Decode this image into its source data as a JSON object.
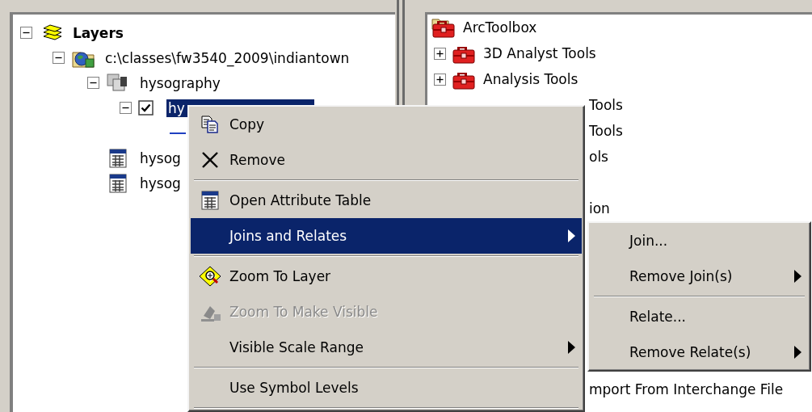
{
  "layers_panel": {
    "tree": [
      {
        "kind": "dataframe",
        "label": "Layers",
        "expanded": true,
        "selected": false,
        "children": [
          {
            "kind": "workspace",
            "label": "c:\\classes\\fw3540_2009\\indiantown",
            "expanded": true,
            "selected": false,
            "children": [
              {
                "kind": "group",
                "label": "hysography",
                "expanded": true,
                "selected": false,
                "children": [
                  {
                    "kind": "layer",
                    "label": "hy",
                    "expanded": true,
                    "checked": true,
                    "selected": true
                  }
                ]
              },
              {
                "kind": "table",
                "label": "hysog",
                "selected": false
              },
              {
                "kind": "table",
                "label": "hysog",
                "selected": false
              }
            ]
          }
        ]
      }
    ]
  },
  "toolbox_panel": {
    "root": "ArcToolbox",
    "toolsets": [
      {
        "label": "3D Analyst Tools",
        "expanded": false
      },
      {
        "label": "Analysis Tools",
        "expanded": false
      }
    ],
    "partly_hidden_rows": [
      "Tools",
      "Tools",
      "ols",
      "ion",
      "mport From Interchange File"
    ]
  },
  "context_menu": {
    "items": [
      {
        "kind": "command",
        "label": "Copy",
        "selected": false,
        "disabled": false,
        "submenu": false
      },
      {
        "kind": "command",
        "label": "Remove",
        "selected": false,
        "disabled": false,
        "submenu": false
      },
      {
        "kind": "separator"
      },
      {
        "kind": "command",
        "label": "Open Attribute Table",
        "selected": false,
        "disabled": false,
        "submenu": false
      },
      {
        "kind": "command",
        "label": "Joins and Relates",
        "selected": true,
        "disabled": false,
        "submenu": true
      },
      {
        "kind": "separator"
      },
      {
        "kind": "command",
        "label": "Zoom To Layer",
        "selected": false,
        "disabled": false,
        "submenu": false
      },
      {
        "kind": "command",
        "label": "Zoom To Make Visible",
        "selected": false,
        "disabled": true,
        "submenu": false
      },
      {
        "kind": "command",
        "label": "Visible Scale Range",
        "selected": false,
        "disabled": false,
        "submenu": true
      },
      {
        "kind": "separator"
      },
      {
        "kind": "command",
        "label": "Use Symbol Levels",
        "selected": false,
        "disabled": false,
        "submenu": false
      },
      {
        "kind": "separator"
      }
    ]
  },
  "submenu": {
    "items": [
      {
        "kind": "command",
        "label": "Join...",
        "selected": false,
        "disabled": false,
        "submenu": false
      },
      {
        "kind": "command",
        "label": "Remove Join(s)",
        "selected": false,
        "disabled": false,
        "submenu": true
      },
      {
        "kind": "separator"
      },
      {
        "kind": "command",
        "label": "Relate...",
        "selected": false,
        "disabled": false,
        "submenu": false
      },
      {
        "kind": "command",
        "label": "Remove Relate(s)",
        "selected": false,
        "disabled": false,
        "submenu": true
      }
    ]
  }
}
